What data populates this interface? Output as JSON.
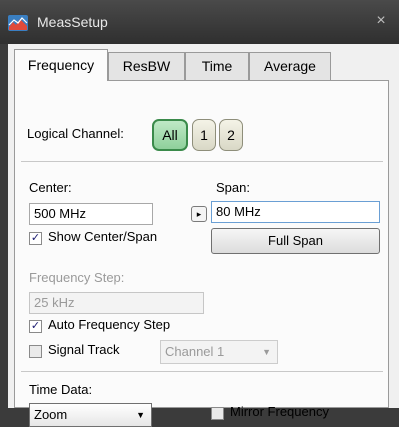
{
  "window": {
    "title": "MeasSetup",
    "close_glyph": "×"
  },
  "tabs": [
    {
      "label": "Frequency",
      "active": true
    },
    {
      "label": "ResBW",
      "active": false
    },
    {
      "label": "Time",
      "active": false
    },
    {
      "label": "Average",
      "active": false
    }
  ],
  "logical_channel": {
    "label": "Logical Channel:",
    "options": [
      "All",
      "1",
      "2"
    ],
    "selected": "All"
  },
  "center": {
    "label": "Center:",
    "value": "500 MHz",
    "step_glyph": "▸",
    "show_center_span": {
      "label": "Show Center/Span",
      "checked": true
    }
  },
  "span": {
    "label": "Span:",
    "value": "80 MHz",
    "full_span_label": "Full Span"
  },
  "frequency_step": {
    "label": "Frequency Step:",
    "value": "25 kHz",
    "enabled": false
  },
  "auto_frequency_step": {
    "label": "Auto Frequency Step",
    "checked": true
  },
  "signal_track": {
    "label": "Signal Track",
    "checked": false,
    "channel_value": "Channel 1",
    "channel_enabled": false
  },
  "time_data": {
    "label": "Time Data:",
    "value": "Zoom"
  },
  "mirror_frequency": {
    "label": "Mirror Frequency",
    "checked": false
  },
  "check_glyph": "✓",
  "caret_glyph": "▼"
}
